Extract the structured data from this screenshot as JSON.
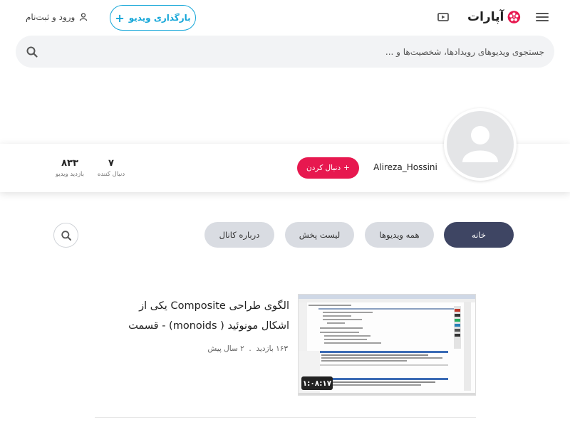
{
  "header": {
    "menu_icon": "menu-icon",
    "logo_text": "آپارات",
    "brand_color": "#e7184f",
    "upload_label": "بارگذاری ویدیو",
    "login_label": "ورود و ثبت‌نام"
  },
  "search": {
    "placeholder": "جستجوی ویدیوهای رویدادها، شخصیت‌ها و ..."
  },
  "channel": {
    "name": "Alireza_Hossini",
    "follow_label": "دنبال کردن",
    "followers_value": "۷",
    "followers_label": "دنبال کننده",
    "views_value": "۸۳۳",
    "views_label": "بازدید ویدیو"
  },
  "tabs": [
    {
      "label": "خانه",
      "active": true
    },
    {
      "label": "همه ویدیوها",
      "active": false
    },
    {
      "label": "لیست پخش",
      "active": false
    },
    {
      "label": "درباره کانال",
      "active": false
    }
  ],
  "video": {
    "title": "الگوی طراحی Composite یکی از اشکال مونوئید ( monoids) - قسمت",
    "views": "۱۶۳ بازدید",
    "age": "۲ سال پیش",
    "duration": "۱:۰۸:۱۷"
  }
}
